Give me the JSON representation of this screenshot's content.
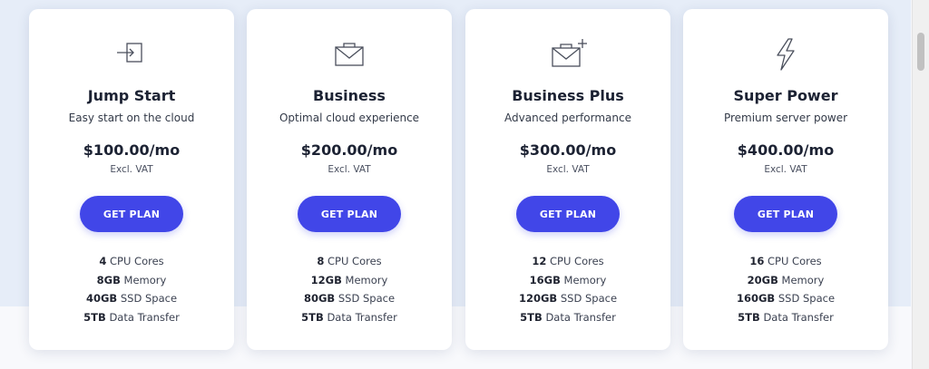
{
  "colors": {
    "accent": "#4146e8",
    "background_top": "#e6edf8",
    "card": "#ffffff"
  },
  "plans": [
    {
      "icon": "sign-in-icon",
      "name": "Jump Start",
      "tagline": "Easy start on the cloud",
      "price": "$100.00/mo",
      "price_note": "Excl. VAT",
      "button_label": "GET PLAN",
      "features": [
        {
          "value": "4",
          "label": "CPU Cores"
        },
        {
          "value": "8GB",
          "label": "Memory"
        },
        {
          "value": "40GB",
          "label": "SSD Space"
        },
        {
          "value": "5TB",
          "label": "Data Transfer"
        }
      ]
    },
    {
      "icon": "envelope-icon",
      "name": "Business",
      "tagline": "Optimal cloud experience",
      "price": "$200.00/mo",
      "price_note": "Excl. VAT",
      "button_label": "GET PLAN",
      "features": [
        {
          "value": "8",
          "label": "CPU Cores"
        },
        {
          "value": "12GB",
          "label": "Memory"
        },
        {
          "value": "80GB",
          "label": "SSD Space"
        },
        {
          "value": "5TB",
          "label": "Data Transfer"
        }
      ]
    },
    {
      "icon": "envelope-plus-icon",
      "name": "Business Plus",
      "tagline": "Advanced performance",
      "price": "$300.00/mo",
      "price_note": "Excl. VAT",
      "button_label": "GET PLAN",
      "features": [
        {
          "value": "12",
          "label": "CPU Cores"
        },
        {
          "value": "16GB",
          "label": "Memory"
        },
        {
          "value": "120GB",
          "label": "SSD Space"
        },
        {
          "value": "5TB",
          "label": "Data Transfer"
        }
      ]
    },
    {
      "icon": "lightning-icon",
      "name": "Super Power",
      "tagline": "Premium server power",
      "price": "$400.00/mo",
      "price_note": "Excl. VAT",
      "button_label": "GET PLAN",
      "features": [
        {
          "value": "16",
          "label": "CPU Cores"
        },
        {
          "value": "20GB",
          "label": "Memory"
        },
        {
          "value": "160GB",
          "label": "SSD Space"
        },
        {
          "value": "5TB",
          "label": "Data Transfer"
        }
      ]
    }
  ]
}
